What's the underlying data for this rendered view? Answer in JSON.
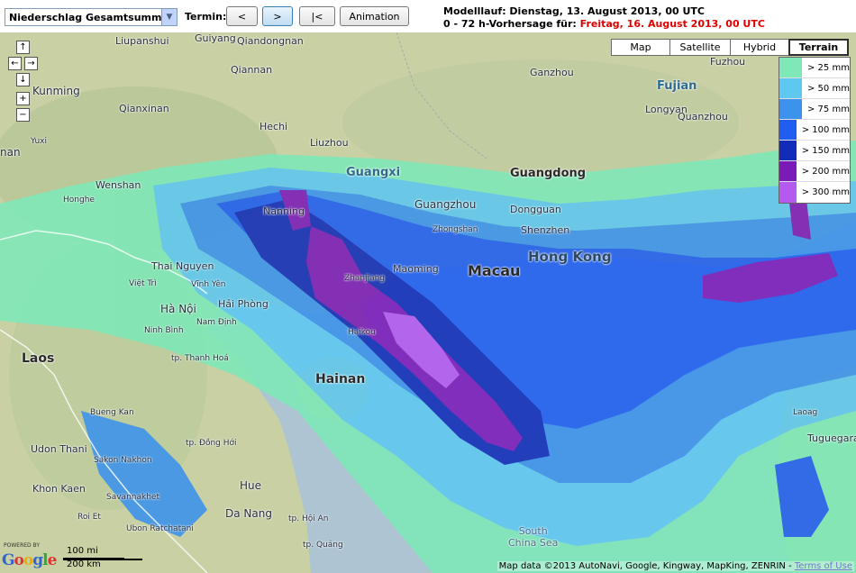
{
  "toolbar": {
    "parameter_select": "Niederschlag Gesamtsumme",
    "termin_label": "Termin:",
    "prev_label": "<",
    "next_label": ">",
    "first_label": "|<",
    "animation_label": "Animation"
  },
  "header": {
    "model_run": "Modelllauf: Dienstag, 13. August 2013, 00 UTC",
    "forecast_prefix": "0 - 72 h-Vorhersage für: ",
    "forecast_date": "Freitag, 16. August 2013, 00 UTC"
  },
  "map_controls": {
    "pan_up": "↑",
    "pan_left": "←",
    "pan_right": "→",
    "pan_down": "↓",
    "zoom_in": "+",
    "zoom_out": "−"
  },
  "map_types": [
    {
      "label": "Map",
      "active": false
    },
    {
      "label": "Satellite",
      "active": false
    },
    {
      "label": "Hybrid",
      "active": false
    },
    {
      "label": "Terrain",
      "active": true
    }
  ],
  "legend": [
    {
      "label": "> 25 mm",
      "color": "#7ee8b8"
    },
    {
      "label": "> 50 mm",
      "color": "#5ec8f0"
    },
    {
      "label": "> 75 mm",
      "color": "#3c92ec"
    },
    {
      "label": "> 100 mm",
      "color": "#1f5ef0"
    },
    {
      "label": "> 150 mm",
      "color": "#102cb8"
    },
    {
      "label": "> 200 mm",
      "color": "#7a1ab8"
    },
    {
      "label": "> 300 mm",
      "color": "#b45af0"
    }
  ],
  "map_labels": {
    "laos": "Laos",
    "hainan": "Hainan",
    "macau": "Macau",
    "hong_kong": "Hong Kong",
    "guangdong": "Guangdong",
    "guangxi": "Guangxi",
    "fujian": "Fujian",
    "kunming": "Kunming",
    "nanning": "Nanning",
    "guangzhou": "Guangzhou",
    "shenzhen": "Shenzhen",
    "zhanjiang": "Zhanjiang",
    "maoming": "Maoming",
    "haikou": "Haikou",
    "dongguan": "Dongguan",
    "zhongshan": "Zhongshan",
    "ha_noi": "Hà Nội",
    "hai_phong": "Hải Phòng",
    "thai_nguyen": "Thai Nguyen",
    "vinh_yen": "Vĩnh Yên",
    "viet_tri": "Việt Trì",
    "nam_dinh": "Nam Định",
    "ninh_binh": "Ninh Bình",
    "hue": "Hue",
    "da_nang": "Da Nang",
    "udon_thani": "Udon Thani",
    "sakon_nakhon": "Sakon\nNakhon",
    "khon_kaen": "Khon Kaen",
    "savannakhet": "Savannakhet",
    "roi_et": "Roi Et",
    "ubon": "Ubon\nRatchatani",
    "buon_kan": "Bueng Kan",
    "dong_hoi": "tp. Đồng Hới",
    "thanh_hoa": "tp. Thanh\nHoá",
    "hoi_an": "tp. Hội An",
    "quang_ngai": "tp. Quảng",
    "liupanshui": "Liupanshui",
    "guiyang": "Guiyang",
    "qiandongnan": "Qiandongnan",
    "qiannan": "Qiannan",
    "qianxinan": "Qianxinan",
    "hechi": "Hechi",
    "liuzhou": "Liuzhou",
    "wenshan": "Wenshan",
    "honghe": "Honghe",
    "ganzhou": "Ganzhou",
    "longyan": "Longyan",
    "quanzhou": "Quanzhou",
    "fuzhou": "Fuzhou",
    "yuxi": "Yuxi",
    "nan": "nan",
    "laoag": "Laoag",
    "tuguegarao": "Tuguegarao",
    "south_china_sea": "South\nChina Sea"
  },
  "scale": {
    "miles": "100 mi",
    "km": "200 km"
  },
  "google": {
    "powered": "POWERED BY",
    "logo_g": "G",
    "logo_o1": "o",
    "logo_o2": "o",
    "logo_g2": "g",
    "logo_l": "l",
    "logo_e": "e"
  },
  "attribution": {
    "text": "Map data ©2013 AutoNavi, Google, Kingway, MapKing, ZENRIN - ",
    "terms": "Terms of Use"
  },
  "colors": {
    "land": "#c9d2a7",
    "sea": "#aec4d3",
    "forecast_highlight": "#e00000"
  }
}
